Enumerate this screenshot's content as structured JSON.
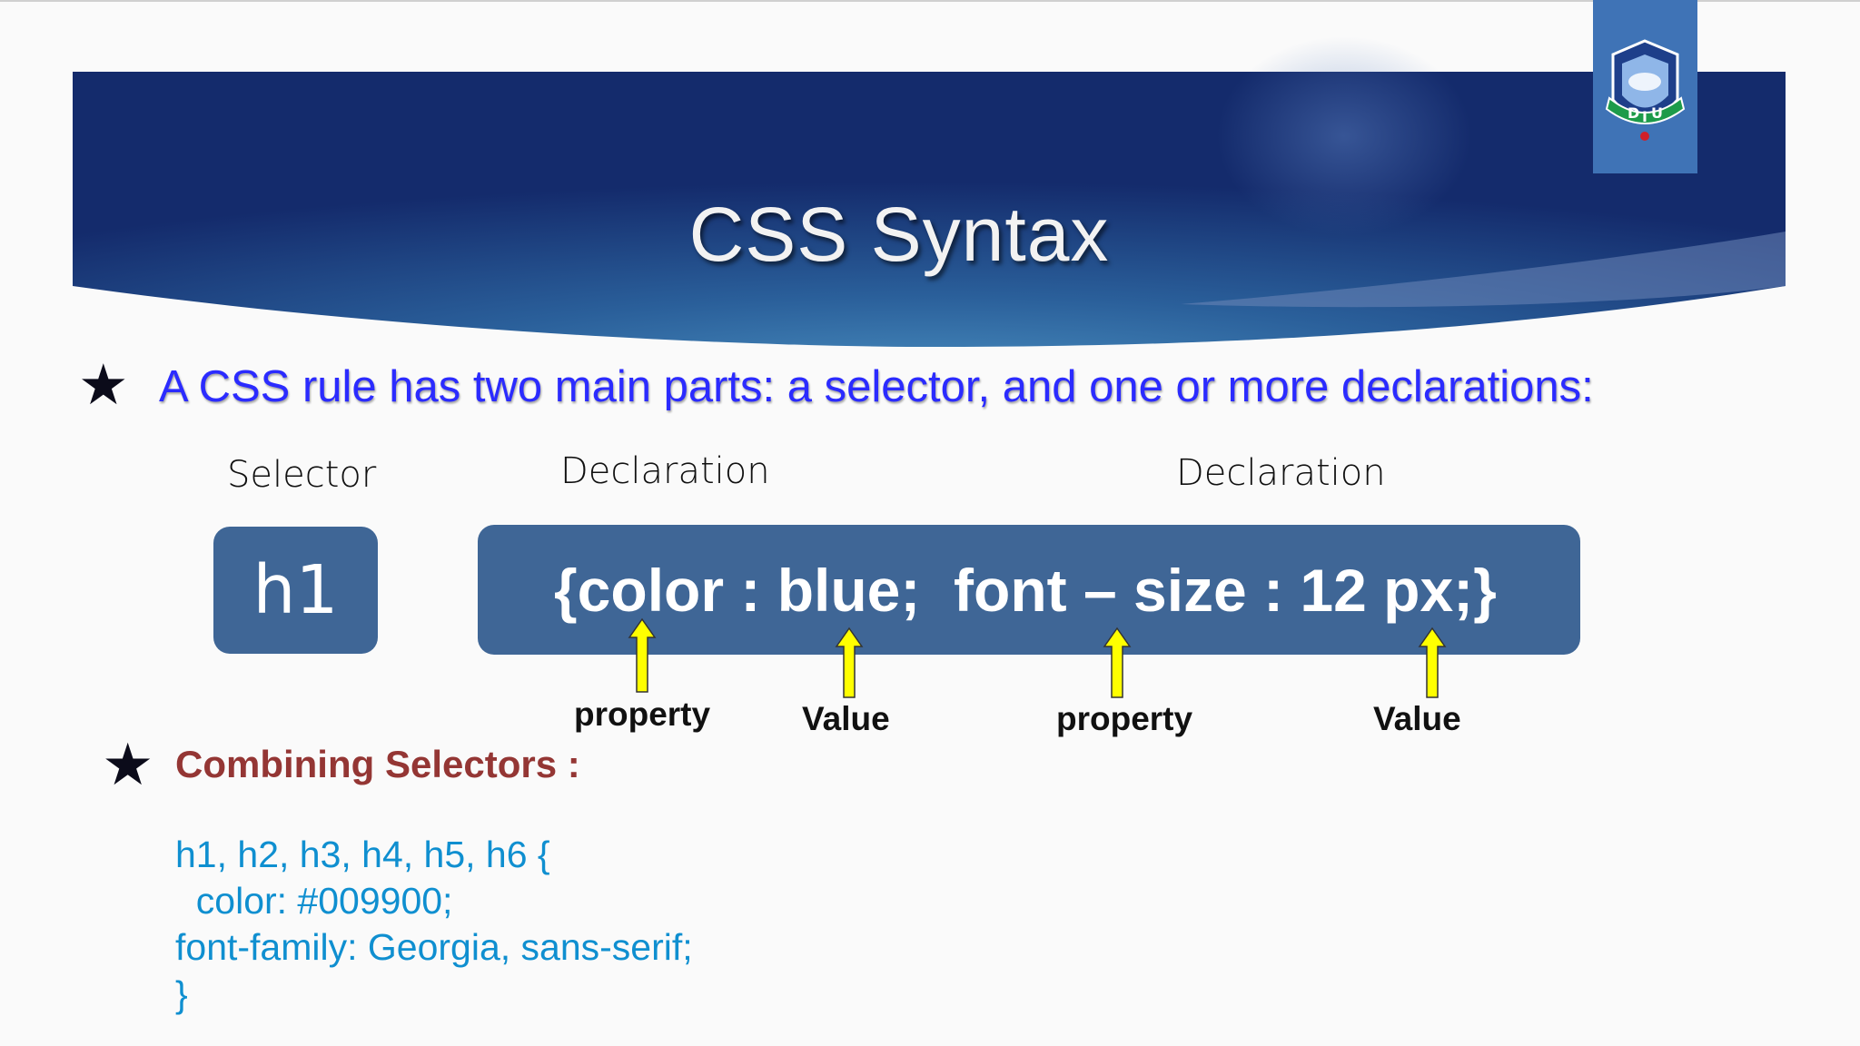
{
  "slide": {
    "title": "CSS Syntax",
    "logo": {
      "text": "DIU",
      "icon": "diu-university-logo"
    }
  },
  "intro": {
    "bullet_icon": "star-icon",
    "text": "A CSS rule has two main parts: a selector, and one or more declarations:"
  },
  "diagram": {
    "selector_label": "Selector",
    "declaration_label_1": "Declaration",
    "declaration_label_2": "Declaration",
    "selector_text": "h1",
    "declaration_text": "{color : blue;  font – size : 12 px;}",
    "annotations": {
      "property_1": "property",
      "value_1": "Value",
      "property_2": "property",
      "value_2": "Value"
    },
    "colors": {
      "box": "#3f6696",
      "arrow": "#ffff00"
    }
  },
  "combining": {
    "bullet_icon": "star-icon",
    "heading": "Combining Selectors :",
    "code": [
      "h1, h2, h3, h4, h5, h6 {",
      "  color: #009900;",
      "font-family: Georgia, sans-serif;",
      "}"
    ]
  }
}
